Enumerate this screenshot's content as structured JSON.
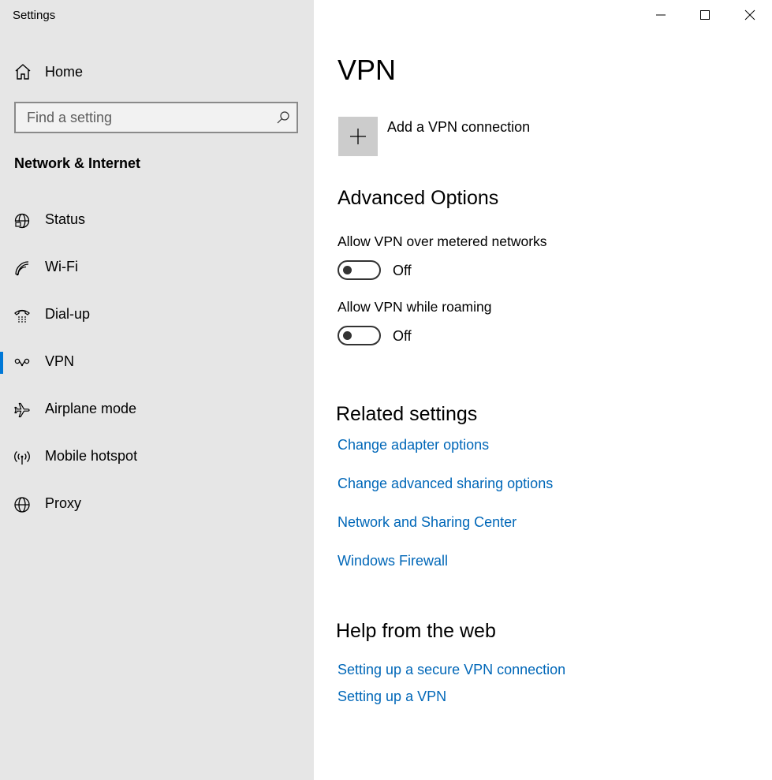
{
  "window": {
    "title": "Settings",
    "controls": {
      "minimize": "minimize-icon",
      "maximize": "maximize-icon",
      "close": "close-icon"
    }
  },
  "sidebar": {
    "home_label": "Home",
    "search_placeholder": "Find a setting",
    "section_title": "Network & Internet",
    "items": [
      {
        "label": "Status",
        "icon": "globe-status-icon"
      },
      {
        "label": "Wi-Fi",
        "icon": "wifi-icon"
      },
      {
        "label": "Dial-up",
        "icon": "dialup-icon"
      },
      {
        "label": "VPN",
        "icon": "vpn-icon",
        "selected": true
      },
      {
        "label": "Airplane mode",
        "icon": "airplane-icon"
      },
      {
        "label": "Mobile hotspot",
        "icon": "hotspot-icon"
      },
      {
        "label": "Proxy",
        "icon": "globe-icon"
      }
    ]
  },
  "main": {
    "title": "VPN",
    "add_connection_label": "Add a VPN connection",
    "advanced_title": "Advanced Options",
    "settings": [
      {
        "label": "Allow VPN over metered networks",
        "state": "Off"
      },
      {
        "label": "Allow VPN while roaming",
        "state": "Off"
      }
    ],
    "related_title": "Related settings",
    "related_links": [
      "Change adapter options",
      "Change advanced sharing options",
      "Network and Sharing Center",
      "Windows Firewall"
    ],
    "help_title": "Help from the web",
    "help_links": [
      "Setting up a secure VPN connection",
      "Setting up a VPN"
    ]
  },
  "colors": {
    "accent": "#0078d7",
    "link": "#0067b8",
    "sidebar_bg": "#e6e6e6",
    "tile_bg": "#cccccc"
  }
}
